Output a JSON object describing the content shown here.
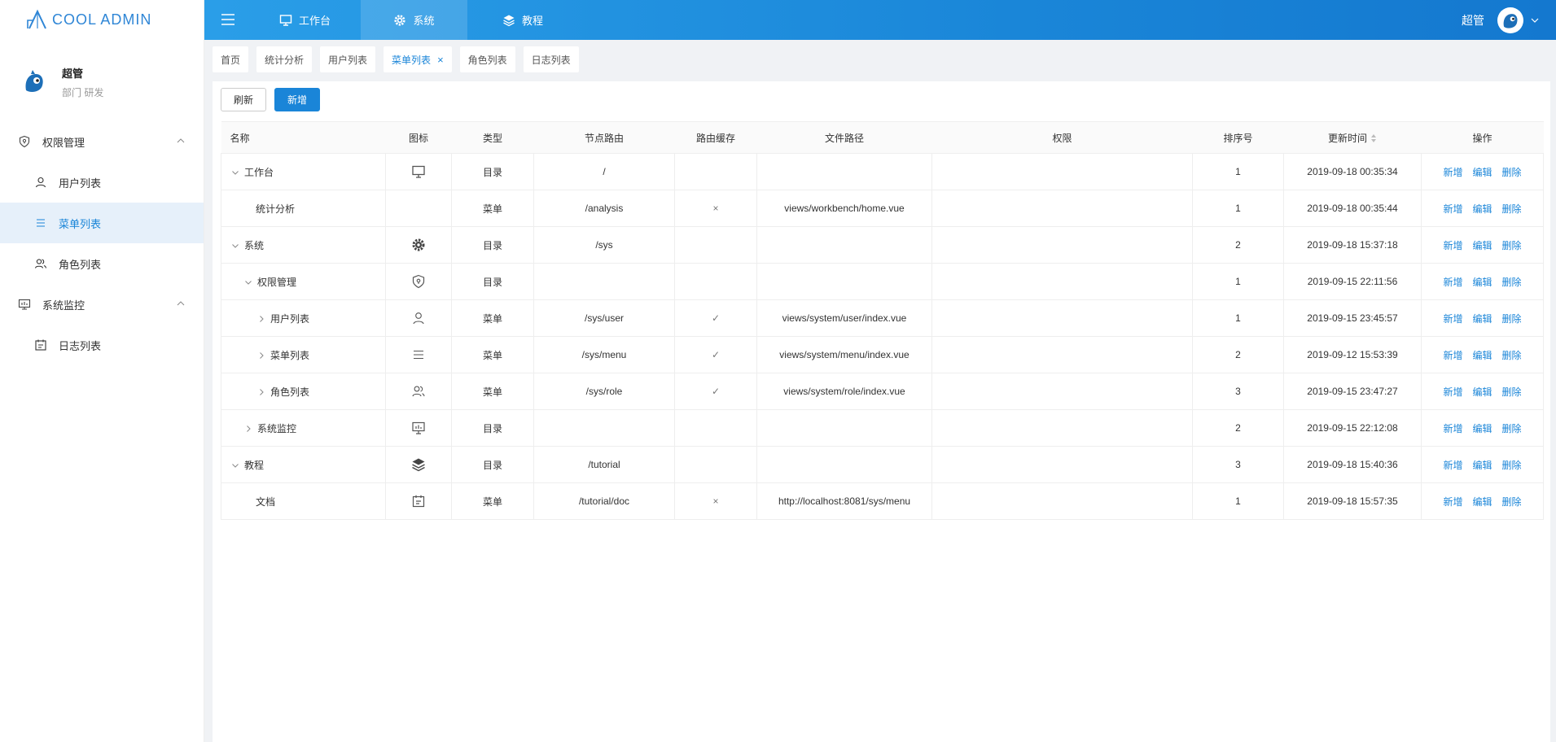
{
  "app": {
    "logo_text": "COOL ADMIN"
  },
  "profile": {
    "name": "超管",
    "dept": "部门 研发"
  },
  "sidebar": {
    "groups": [
      {
        "label": "权限管理",
        "icon": "shield-icon",
        "items": [
          {
            "label": "用户列表",
            "icon": "user-icon"
          },
          {
            "label": "菜单列表",
            "icon": "menu-list-icon",
            "active": true
          },
          {
            "label": "角色列表",
            "icon": "users-icon"
          }
        ]
      },
      {
        "label": "系统监控",
        "icon": "monitor-chart-icon",
        "items": [
          {
            "label": "日志列表",
            "icon": "calendar-icon"
          }
        ]
      }
    ]
  },
  "topbar": {
    "tabs": [
      {
        "label": "工作台",
        "icon": "monitor-icon"
      },
      {
        "label": "系统",
        "icon": "gear-icon",
        "active": true
      },
      {
        "label": "教程",
        "icon": "layers-icon"
      }
    ],
    "user": "超管"
  },
  "tabs": [
    {
      "label": "首页"
    },
    {
      "label": "统计分析"
    },
    {
      "label": "用户列表"
    },
    {
      "label": "菜单列表",
      "active": true,
      "closable": true
    },
    {
      "label": "角色列表"
    },
    {
      "label": "日志列表"
    }
  ],
  "toolbar": {
    "refresh_label": "刷新",
    "add_label": "新增"
  },
  "table": {
    "columns": [
      "名称",
      "图标",
      "类型",
      "节点路由",
      "路由缓存",
      "文件路径",
      "权限",
      "排序号",
      "更新时间",
      "操作"
    ],
    "rows": [
      {
        "name": "工作台",
        "icon": "monitor-icon",
        "type": "目录",
        "route": "/",
        "cache": "",
        "path": "",
        "perm": "",
        "order": "1",
        "time": "2019-09-18 00:35:34"
      },
      {
        "name": "统计分析",
        "icon": "",
        "type": "菜单",
        "route": "/analysis",
        "cache": "×",
        "path": "views/workbench/home.vue",
        "perm": "",
        "order": "1",
        "time": "2019-09-18 00:35:44"
      },
      {
        "name": "系统",
        "icon": "gear-icon",
        "type": "目录",
        "route": "/sys",
        "cache": "",
        "path": "",
        "perm": "",
        "order": "2",
        "time": "2019-09-18 15:37:18"
      },
      {
        "name": "权限管理",
        "icon": "shield-icon",
        "type": "目录",
        "route": "",
        "cache": "",
        "path": "",
        "perm": "",
        "order": "1",
        "time": "2019-09-15 22:11:56"
      },
      {
        "name": "用户列表",
        "icon": "user-icon",
        "type": "菜单",
        "route": "/sys/user",
        "cache": "✓",
        "path": "views/system/user/index.vue",
        "perm": "",
        "order": "1",
        "time": "2019-09-15 23:45:57"
      },
      {
        "name": "菜单列表",
        "icon": "menu-list-icon",
        "type": "菜单",
        "route": "/sys/menu",
        "cache": "✓",
        "path": "views/system/menu/index.vue",
        "perm": "",
        "order": "2",
        "time": "2019-09-12 15:53:39"
      },
      {
        "name": "角色列表",
        "icon": "users-icon",
        "type": "菜单",
        "route": "/sys/role",
        "cache": "✓",
        "path": "views/system/role/index.vue",
        "perm": "",
        "order": "3",
        "time": "2019-09-15 23:47:27"
      },
      {
        "name": "系统监控",
        "icon": "monitor-chart-icon",
        "type": "目录",
        "route": "",
        "cache": "",
        "path": "",
        "perm": "",
        "order": "2",
        "time": "2019-09-15 22:12:08"
      },
      {
        "name": "教程",
        "icon": "layers-icon",
        "type": "目录",
        "route": "/tutorial",
        "cache": "",
        "path": "",
        "perm": "",
        "order": "3",
        "time": "2019-09-18 15:40:36"
      },
      {
        "name": "文档",
        "icon": "calendar-icon",
        "type": "菜单",
        "route": "/tutorial/doc",
        "cache": "×",
        "path": "http://localhost:8081/sys/menu",
        "perm": "",
        "order": "1",
        "time": "2019-09-18 15:57:35"
      }
    ],
    "ops": {
      "add": "新增",
      "edit": "编辑",
      "delete": "删除"
    }
  },
  "colors": {
    "primary": "#1a85d8",
    "active_bg": "#e6f0fa"
  }
}
